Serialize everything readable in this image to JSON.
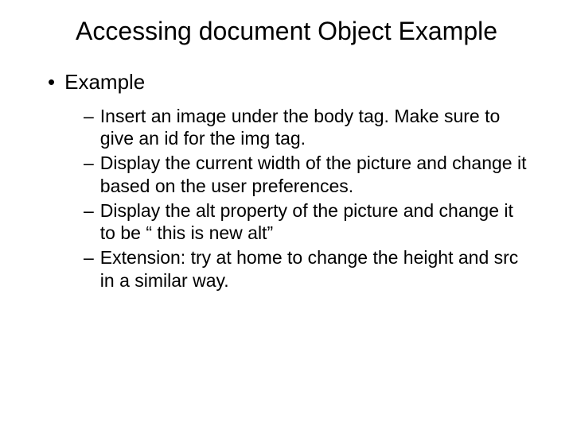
{
  "title": "Accessing document Object Example",
  "bullet": {
    "label": "Example",
    "subitems": [
      "Insert an image under the body tag. Make sure to give an id for the img tag.",
      "Display the current width of the picture and change it based on the user preferences.",
      "Display the alt property of the picture and change it to be “ this is new alt”",
      "Extension: try at home to change the height and src in a similar way."
    ]
  }
}
